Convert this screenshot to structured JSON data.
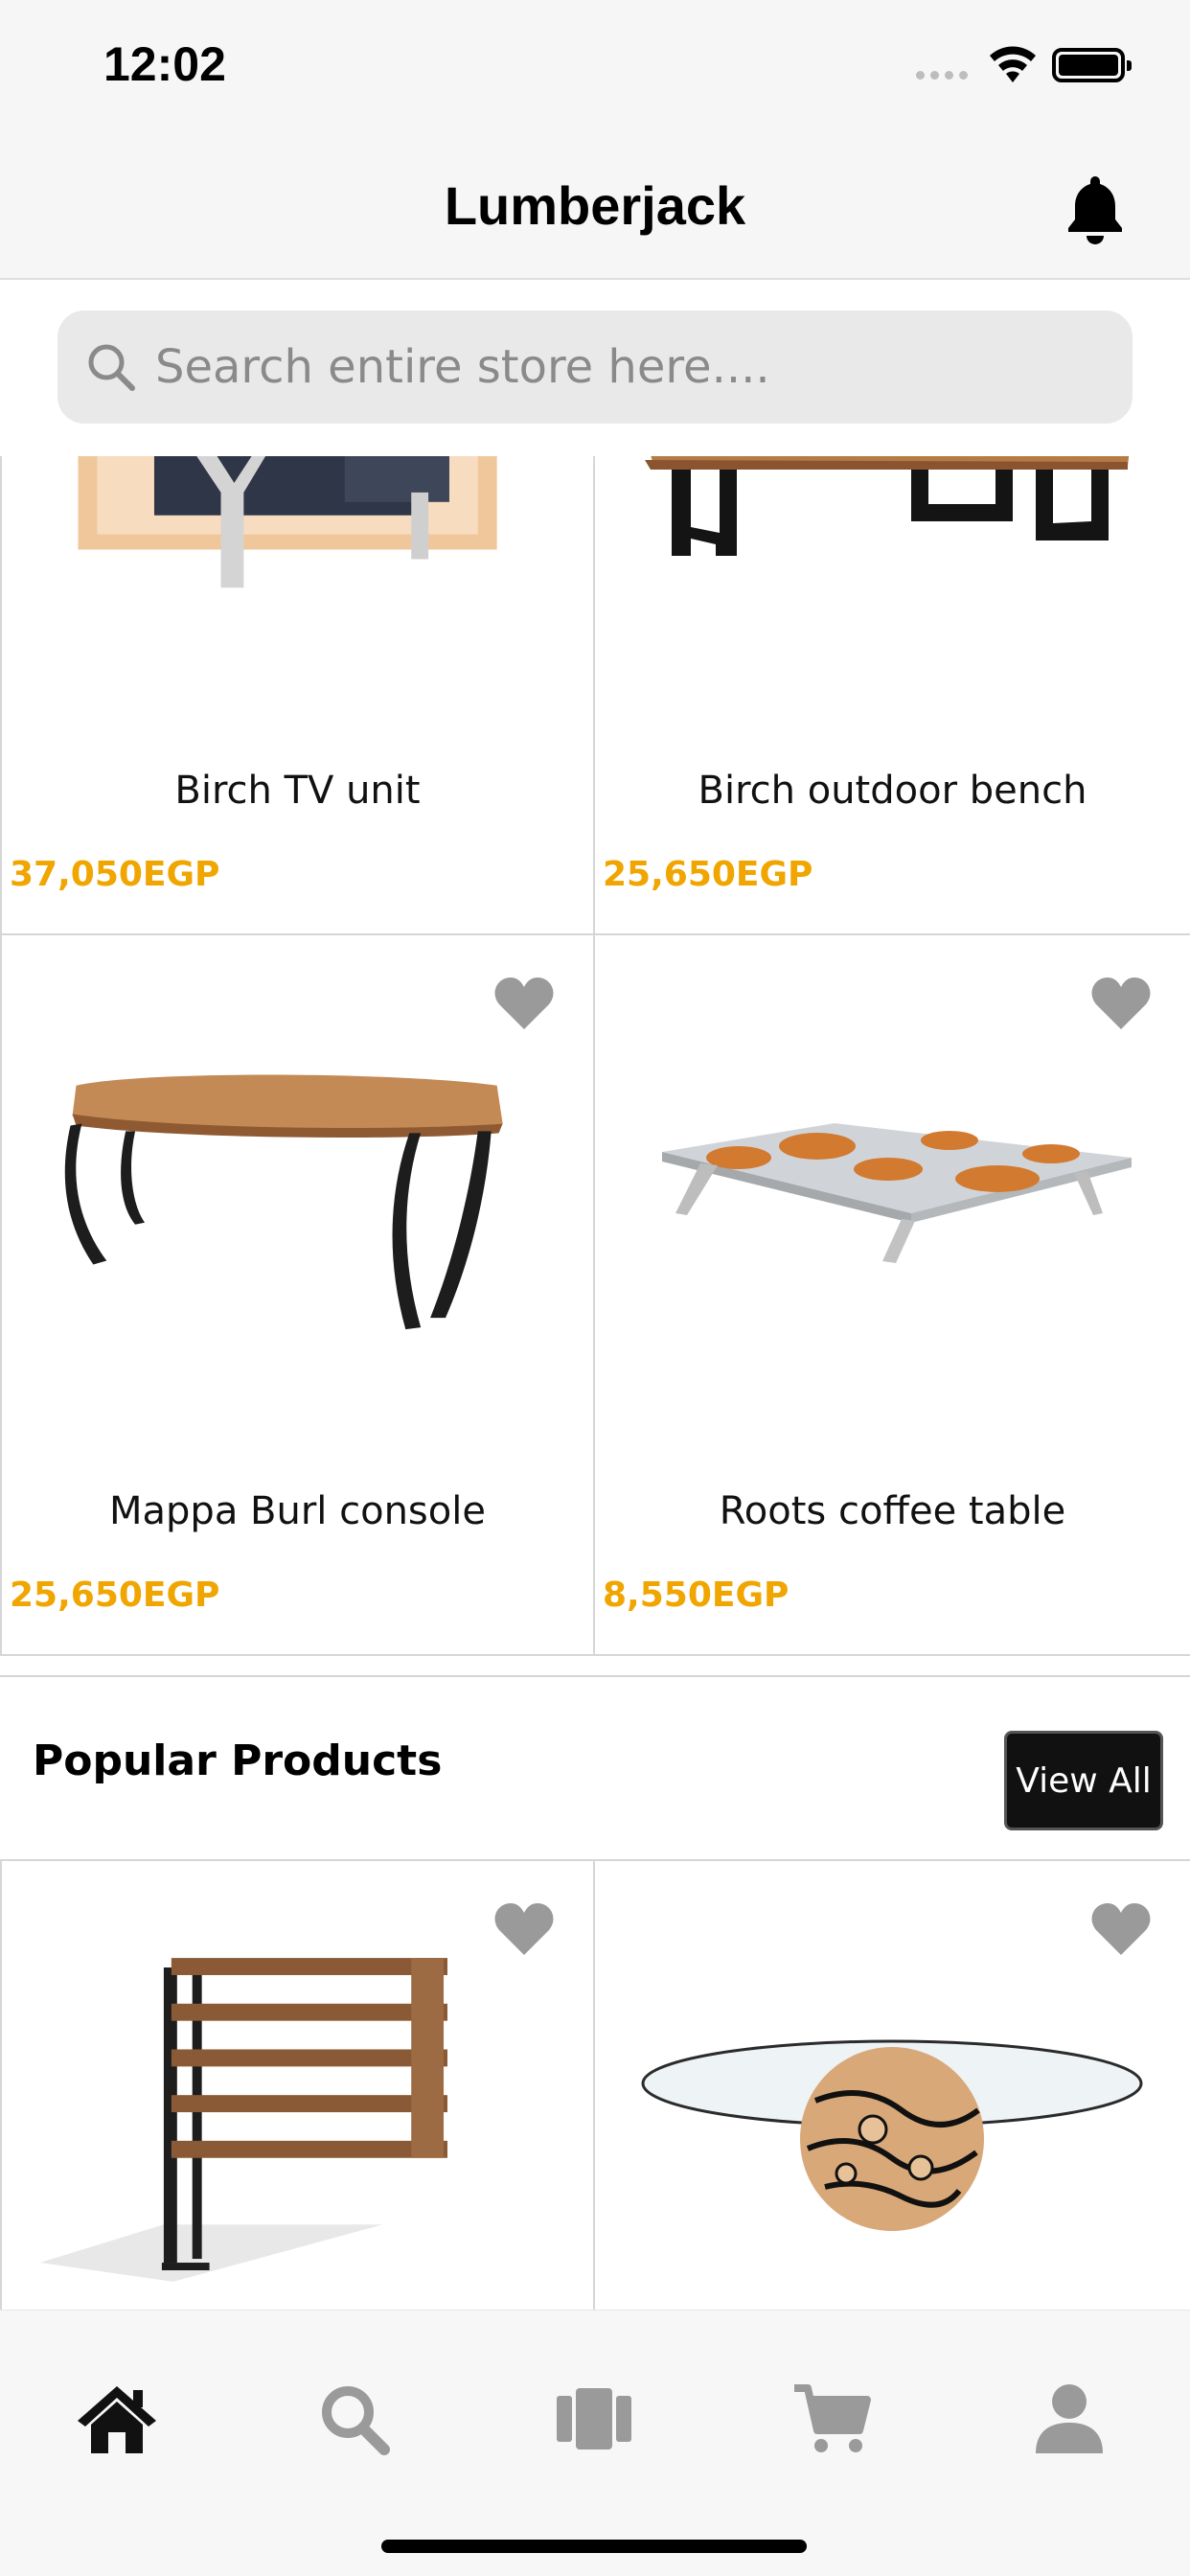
{
  "status_bar": {
    "time": "12:02"
  },
  "header": {
    "title": "Lumberjack"
  },
  "search": {
    "placeholder": "Search entire store here...."
  },
  "products_top": [
    {
      "name": "Birch TV unit",
      "price": "37,050EGP"
    },
    {
      "name": "Birch outdoor bench",
      "price": "25,650EGP"
    },
    {
      "name": "Mappa Burl console",
      "price": "25,650EGP"
    },
    {
      "name": "Roots coffee table",
      "price": "8,550EGP"
    }
  ],
  "popular": {
    "title": "Popular Products",
    "view_all_label": "View All"
  },
  "colors": {
    "price": "#f0a500",
    "accent": "#111111",
    "icon_gray": "#9a9a9a",
    "active_tab": "#111111"
  },
  "tabbar": {
    "items": [
      {
        "icon": "home-icon",
        "active": true
      },
      {
        "icon": "search-icon",
        "active": false
      },
      {
        "icon": "categories-icon",
        "active": false
      },
      {
        "icon": "cart-icon",
        "active": false
      },
      {
        "icon": "profile-icon",
        "active": false
      }
    ]
  }
}
